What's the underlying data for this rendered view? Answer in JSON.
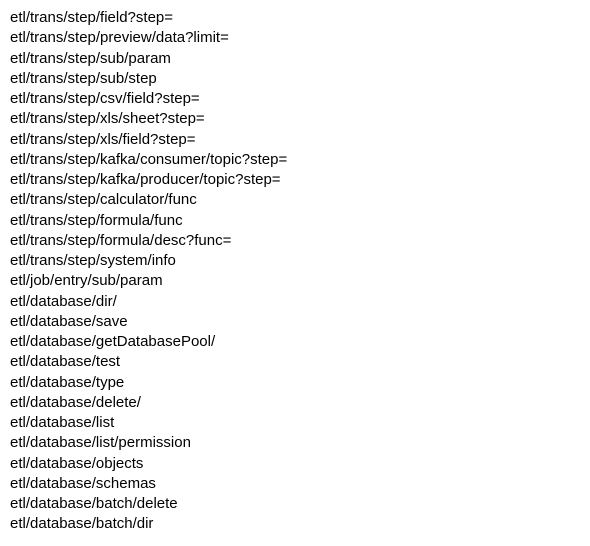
{
  "lines": [
    "etl/trans/step/field?step=",
    "etl/trans/step/preview/data?limit=",
    "etl/trans/step/sub/param",
    "etl/trans/step/sub/step",
    "etl/trans/step/csv/field?step=",
    "etl/trans/step/xls/sheet?step=",
    "etl/trans/step/xls/field?step=",
    "etl/trans/step/kafka/consumer/topic?step=",
    "etl/trans/step/kafka/producer/topic?step=",
    "etl/trans/step/calculator/func",
    "etl/trans/step/formula/func",
    "etl/trans/step/formula/desc?func=",
    "etl/trans/step/system/info",
    "etl/job/entry/sub/param",
    "etl/database/dir/",
    "etl/database/save",
    "etl/database/getDatabasePool/",
    "etl/database/test",
    "etl/database/type",
    "etl/database/delete/",
    "etl/database/list",
    "etl/database/list/permission",
    "etl/database/objects",
    "etl/database/schemas",
    "etl/database/batch/delete",
    "etl/database/batch/dir"
  ]
}
